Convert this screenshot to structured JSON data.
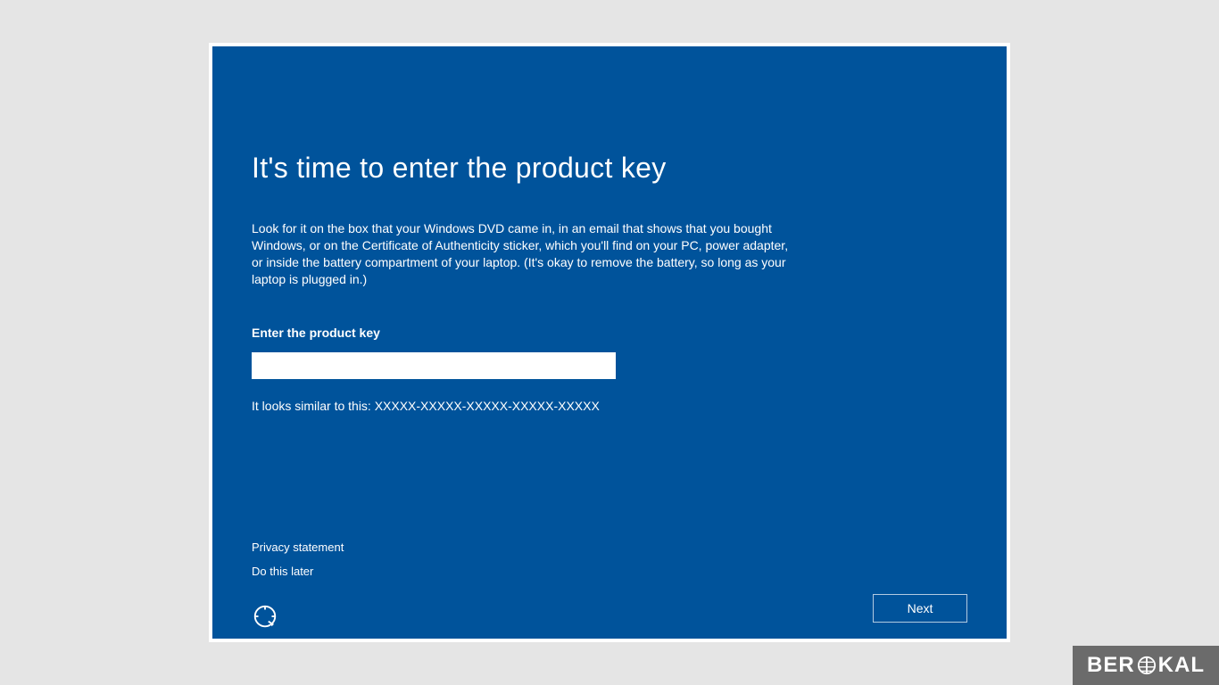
{
  "title": "It's time to enter the product key",
  "description": "Look for it on the box that your Windows DVD came in, in an email that shows that you bought Windows, or on the Certificate of Authenticity sticker, which you'll find on your PC, power adapter, or inside the battery compartment of your laptop. (It's okay to remove the battery, so long as your laptop is plugged in.)",
  "field_label": "Enter the product key",
  "product_key_value": "",
  "hint": "It looks similar to this: XXXXX-XXXXX-XXXXX-XXXXX-XXXXX",
  "links": {
    "privacy": "Privacy statement",
    "skip": "Do this later"
  },
  "next_button": "Next",
  "watermark": {
    "prefix": "BER",
    "suffix": "KAL"
  },
  "colors": {
    "background": "#00539b",
    "page_background": "#e5e5e5",
    "text": "#ffffff"
  }
}
